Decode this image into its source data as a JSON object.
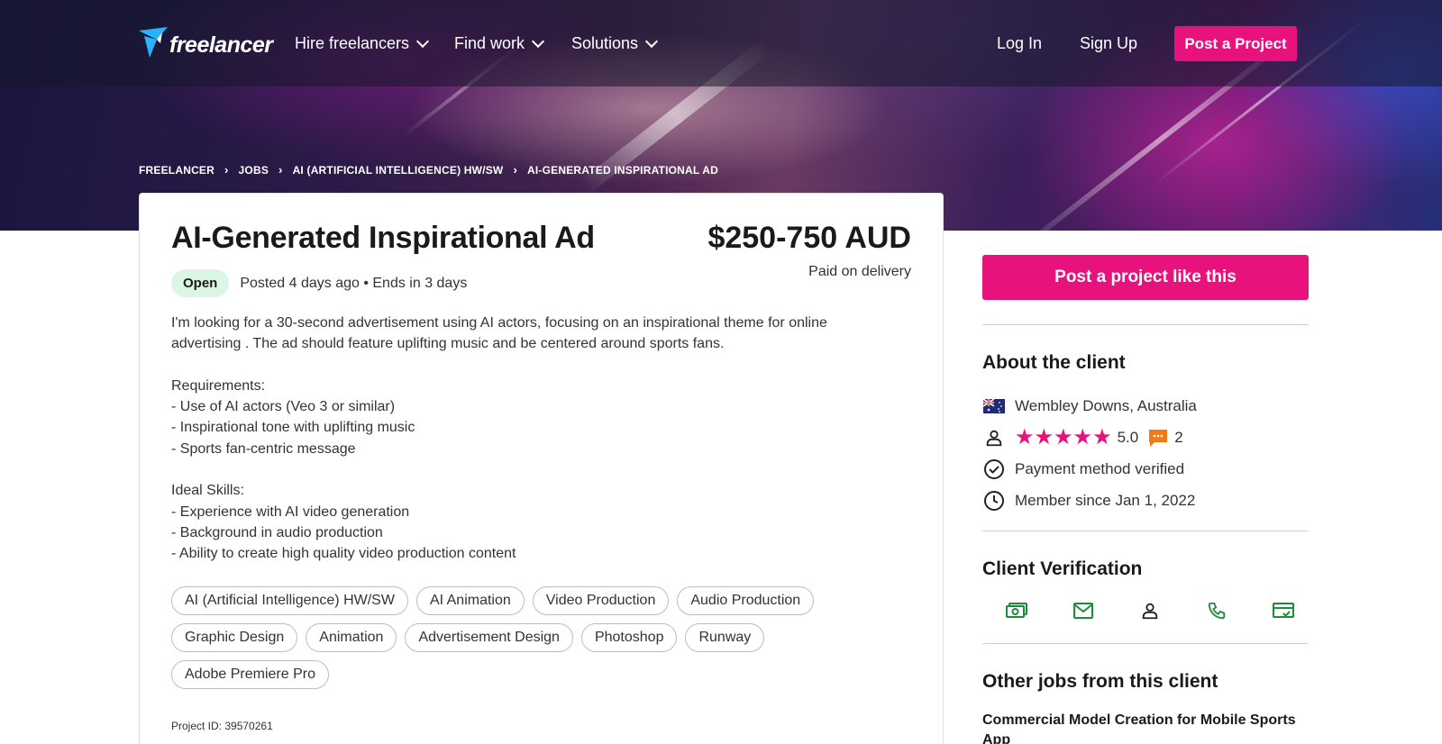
{
  "nav": {
    "logo_text": "freelancer",
    "items": [
      {
        "label": "Hire freelancers"
      },
      {
        "label": "Find work"
      },
      {
        "label": "Solutions"
      }
    ],
    "login": "Log In",
    "signup": "Sign Up",
    "post_project": "Post a Project"
  },
  "breadcrumb": [
    "FREELANCER",
    "JOBS",
    "AI (ARTIFICIAL INTELLIGENCE) HW/SW",
    "AI-GENERATED INSPIRATIONAL AD"
  ],
  "project": {
    "title": "AI-Generated Inspirational Ad",
    "budget": "$250-750 AUD",
    "payment_terms": "Paid on delivery",
    "status": "Open",
    "posted": "Posted 4 days ago • Ends in 3 days",
    "description": [
      "I'm looking for a 30-second advertisement using AI actors, focusing on an inspirational theme for online",
      "advertising . The ad should feature uplifting music and be centered around sports fans.",
      "",
      "Requirements:",
      "- Use of AI actors (Veo 3 or similar)",
      "- Inspirational tone with uplifting music",
      "- Sports fan-centric message",
      "",
      "Ideal Skills:",
      "- Experience with AI video generation",
      "- Background in audio production",
      "- Ability to create high quality video production content"
    ],
    "skills": [
      "AI (Artificial Intelligence) HW/SW",
      "AI Animation",
      "Video Production",
      "Audio Production",
      "Graphic Design",
      "Animation",
      "Advertisement Design",
      "Photoshop",
      "Runway",
      "Adobe Premiere Pro"
    ],
    "project_id": "Project ID: 39570261"
  },
  "sidebar": {
    "post_like_this": "Post a project like this",
    "about_heading": "About the client",
    "location": "Wembley Downs, Australia",
    "rating": "5.0",
    "reviews": "2",
    "payment_verified": "Payment method verified",
    "member_since": "Member since Jan 1, 2022",
    "verification_heading": "Client Verification",
    "other_jobs_heading": "Other jobs from this client",
    "other_job_title": "Commercial Model Creation for Mobile Sports App"
  },
  "colors": {
    "accent": "#e8127c",
    "verified": "#1e8a3c",
    "badge_bg": "#dcf6e4"
  }
}
